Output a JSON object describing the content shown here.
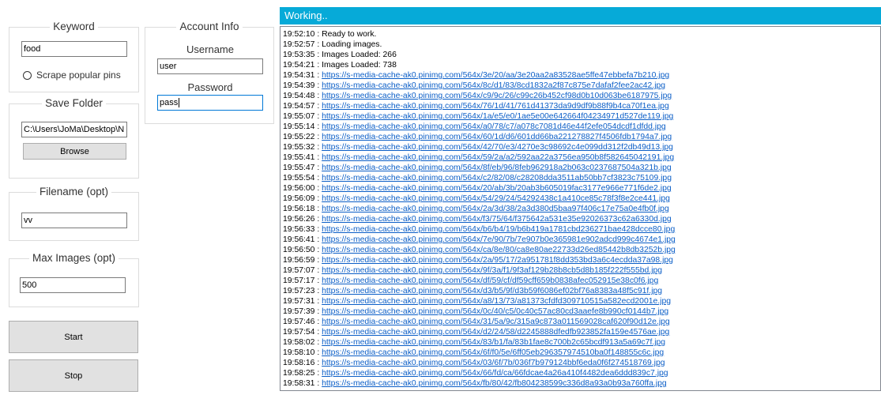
{
  "keyword": {
    "title": "Keyword",
    "value": "food",
    "scrape_label": "Scrape popular pins"
  },
  "account": {
    "title": "Account Info",
    "username_label": "Username",
    "username_value": "user",
    "password_label": "Password",
    "password_value": "pass"
  },
  "save_folder": {
    "title": "Save Folder",
    "value": "C:\\Users\\JoMa\\Desktop\\N",
    "browse_label": "Browse"
  },
  "filename": {
    "title": "Filename (opt)",
    "value": "vv"
  },
  "max_images": {
    "title": "Max Images (opt)",
    "value": "500"
  },
  "buttons": {
    "start": "Start",
    "stop": "Stop"
  },
  "status": {
    "text": "Working.."
  },
  "log": [
    {
      "time": "19:52:10",
      "text": "Ready to work."
    },
    {
      "time": "19:52:57",
      "text": "Loading images."
    },
    {
      "time": "19:53:35",
      "text": "Images Loaded: 266"
    },
    {
      "time": "19:54:21",
      "text": "Images Loaded: 738"
    },
    {
      "time": "19:54:31",
      "url": "https://s-media-cache-ak0.pinimg.com/564x/3e/20/aa/3e20aa2a83528ae5ffe47ebbefa7b210.jpg"
    },
    {
      "time": "19:54:39",
      "url": "https://s-media-cache-ak0.pinimg.com/564x/8c/d1/83/8cd1832a2f87c875e7dafaf2fee2ac42.jpg"
    },
    {
      "time": "19:54:48",
      "url": "https://s-media-cache-ak0.pinimg.com/564x/c9/9c/26/c99c26b452cf98d0b10d063be6187975.jpg"
    },
    {
      "time": "19:54:57",
      "url": "https://s-media-cache-ak0.pinimg.com/564x/76/1d/41/761d41373da9d9df9b88f9b4ca70f1ea.jpg"
    },
    {
      "time": "19:55:07",
      "url": "https://s-media-cache-ak0.pinimg.com/564x/1a/e5/e0/1ae5e00e642664f04234971d527de119.jpg"
    },
    {
      "time": "19:55:14",
      "url": "https://s-media-cache-ak0.pinimg.com/564x/a0/78/c7/a078c7081d46e44f2efe054dcdf1dfdd.jpg"
    },
    {
      "time": "19:55:22",
      "url": "https://s-media-cache-ak0.pinimg.com/564x/60/1d/d6/601dd66ba221278827f4506fdb1794a7.jpg"
    },
    {
      "time": "19:55:32",
      "url": "https://s-media-cache-ak0.pinimg.com/564x/42/70/e3/4270e3c98692c4e099dd312f2db49d13.jpg"
    },
    {
      "time": "19:55:41",
      "url": "https://s-media-cache-ak0.pinimg.com/564x/59/2a/a2/592aa22a3756ea950b8f582645042191.jpg"
    },
    {
      "time": "19:55:47",
      "url": "https://s-media-cache-ak0.pinimg.com/564x/8f/eb/96/8feb962918a2b063c0237687504a321b.jpg"
    },
    {
      "time": "19:55:54",
      "url": "https://s-media-cache-ak0.pinimg.com/564x/c2/82/08/c28208dda3511ab50bb7cf3823c75109.jpg"
    },
    {
      "time": "19:56:00",
      "url": "https://s-media-cache-ak0.pinimg.com/564x/20/ab/3b/20ab3b605019fac3177e966e771f6de2.jpg"
    },
    {
      "time": "19:56:09",
      "url": "https://s-media-cache-ak0.pinimg.com/564x/54/29/24/54292438c1a410ce85c78f3f8e2ce441.jpg"
    },
    {
      "time": "19:56:18",
      "url": "https://s-media-cache-ak0.pinimg.com/564x/2a/3d/38/2a3d380d5baa97f406c17e75a0e4fb0f.jpg"
    },
    {
      "time": "19:56:26",
      "url": "https://s-media-cache-ak0.pinimg.com/564x/f3/75/64/f375642a531e35e92026373c62a6330d.jpg"
    },
    {
      "time": "19:56:33",
      "url": "https://s-media-cache-ak0.pinimg.com/564x/b6/b4/19/b6b419a1781cbd236271bae428dcce80.jpg"
    },
    {
      "time": "19:56:41",
      "url": "https://s-media-cache-ak0.pinimg.com/564x/7e/90/7b/7e907b0e365981e902adcd999c4674e1.jpg"
    },
    {
      "time": "19:56:50",
      "url": "https://s-media-cache-ak0.pinimg.com/564x/ca/8e/80/ca8e80ae22733d26ed85442b8db3252b.jpg"
    },
    {
      "time": "19:56:59",
      "url": "https://s-media-cache-ak0.pinimg.com/564x/2a/95/17/2a951781f8dd353bd3a6c4ecdda37a98.jpg"
    },
    {
      "time": "19:57:07",
      "url": "https://s-media-cache-ak0.pinimg.com/564x/9f/3a/f1/9f3af129b28b8cb5d8b185f222f555bd.jpg"
    },
    {
      "time": "19:57:17",
      "url": "https://s-media-cache-ak0.pinimg.com/564x/df/59/cf/df59cff659b0838afec052915e38c0f6.jpg"
    },
    {
      "time": "19:57:23",
      "url": "https://s-media-cache-ak0.pinimg.com/564x/d3/b5/9f/d3b59f6086ef02bf76a8383a48f5c91f.jpg"
    },
    {
      "time": "19:57:31",
      "url": "https://s-media-cache-ak0.pinimg.com/564x/a8/13/73/a81373cfdfd309710515a582ecd2001e.jpg"
    },
    {
      "time": "19:57:39",
      "url": "https://s-media-cache-ak0.pinimg.com/564x/0c/40/c5/0c40c57ac80cd3aaefe8b990cf0144b7.jpg"
    },
    {
      "time": "19:57:46",
      "url": "https://s-media-cache-ak0.pinimg.com/564x/31/5a/9c/315a9c873a011569028caf620f90d12e.jpg"
    },
    {
      "time": "19:57:54",
      "url": "https://s-media-cache-ak0.pinimg.com/564x/d2/24/58/d2245888dfedfb923852fa159e4576ae.jpg"
    },
    {
      "time": "19:58:02",
      "url": "https://s-media-cache-ak0.pinimg.com/564x/83/b1/fa/83b1fae8c700b2c65bcdf913a5a69c7f.jpg"
    },
    {
      "time": "19:58:10",
      "url": "https://s-media-cache-ak0.pinimg.com/564x/6f/f0/5e/6ff05eb296357974510ba0f148855c6c.jpg"
    },
    {
      "time": "19:58:16",
      "url": "https://s-media-cache-ak0.pinimg.com/564x/03/6f/7b/036f7b979124bbf6eda0f6f274518769.jpg"
    },
    {
      "time": "19:58:25",
      "url": "https://s-media-cache-ak0.pinimg.com/564x/66/fd/ca/66fdcae4a26a410f4482dea6ddd839c7.jpg"
    },
    {
      "time": "19:58:31",
      "url": "https://s-media-cache-ak0.pinimg.com/564x/fb/80/42/fb804238599c336d8a93a0b93a760ffa.jpg"
    }
  ]
}
